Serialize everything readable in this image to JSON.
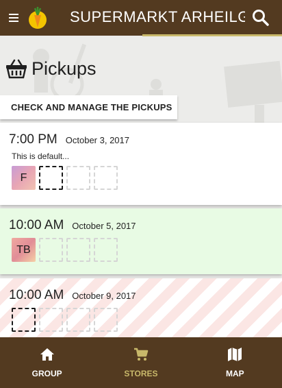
{
  "header": {
    "title": "SUPERMARKT ARHEILGEN",
    "menu_icon": "hamburger-icon",
    "logo_icon": "carrot-logo",
    "search_icon": "search-icon"
  },
  "page": {
    "title": "Pickups",
    "icon": "basket-icon",
    "manage_button": "CHECK AND MANAGE THE PICKUPS"
  },
  "pickups": [
    {
      "time": "7:00 PM",
      "date": "October 3, 2017",
      "description": "This is default...",
      "slots": [
        "F",
        "free",
        "empty",
        "empty"
      ]
    },
    {
      "time": "10:00 AM",
      "date": "October 5, 2017",
      "description": "",
      "slots": [
        "TB",
        "empty",
        "empty",
        "empty"
      ]
    },
    {
      "time": "10:00 AM",
      "date": "October 9, 2017",
      "description": "",
      "slots": [
        "free",
        "empty",
        "empty",
        "empty"
      ]
    }
  ],
  "nav": [
    {
      "label": "GROUP",
      "icon": "home-icon",
      "active": false
    },
    {
      "label": "STORES",
      "icon": "cart-icon",
      "active": true
    },
    {
      "label": "MAP",
      "icon": "map-icon",
      "active": false
    }
  ],
  "colors": {
    "bar": "#533a20",
    "accent": "#c8b86a",
    "card_highlight": "#e8fbe4"
  }
}
